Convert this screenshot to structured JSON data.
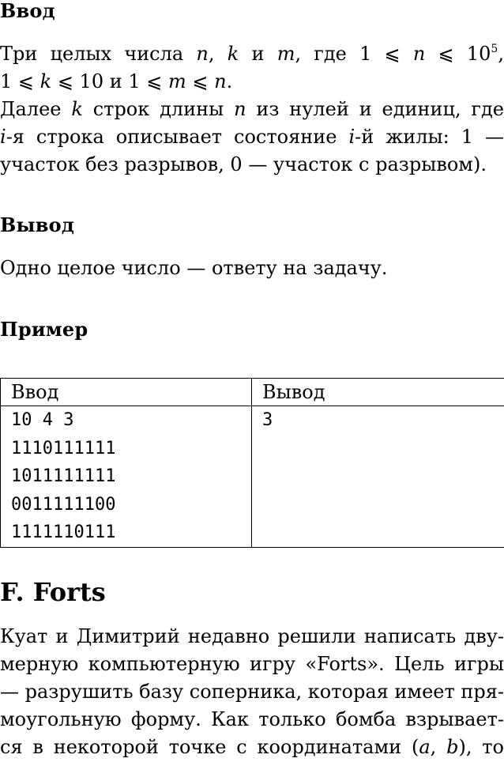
{
  "input_section": {
    "heading": "Ввод",
    "lines": [
      {
        "pre": "Три целых числа ",
        "n": "n",
        "c1": ", ",
        "k": "k",
        "c2": " и ",
        "m": "m",
        "c3": ", где 1 ⩽ ",
        "n2": "n",
        "c4": " ⩽ 10",
        "sup": "5",
        "c5": ","
      },
      {
        "text_a": "1 ⩽ ",
        "k": "k",
        "text_b": " ⩽ 10 и 1 ⩽ ",
        "m": "m",
        "text_c": " ⩽ ",
        "n": "n",
        "text_d": "."
      },
      {
        "text_a": "Далее ",
        "k": "k",
        "text_b": " строк длины ",
        "n": "n",
        "text_c": " из нулей и единиц, где"
      },
      {
        "i1": "i",
        "text_a": "-я строка описывает состояние ",
        "i2": "i",
        "text_b": "-й жилы: 1 —"
      },
      {
        "text": "участок без разрывов, 0 — участок с разрывом)."
      }
    ]
  },
  "output_section": {
    "heading": "Вывод",
    "text": "Одно целое число — ответу на задачу."
  },
  "example_section": {
    "heading": "Пример",
    "table": {
      "headers": [
        "Ввод",
        "Вывод"
      ],
      "input_lines": [
        "10 4 3",
        "1110111111",
        "1011111111",
        "0011111100",
        "1111110111"
      ],
      "output_lines": [
        "3"
      ]
    }
  },
  "problem_f": {
    "title": "F. Forts",
    "lines": [
      "Куат и Димитрий недавно решили написать дву-",
      "мерную компьютерную игру «Forts». Цель игры",
      "— разрушить базу соперника, которая имеет пря-",
      "моугольную форму. Как только бомба взрывает-"
    ],
    "last_line": {
      "text_a": "ся в некоторой точке с координатами (",
      "a": "a",
      "text_b": ", ",
      "b": "b",
      "text_c": "), то"
    }
  }
}
